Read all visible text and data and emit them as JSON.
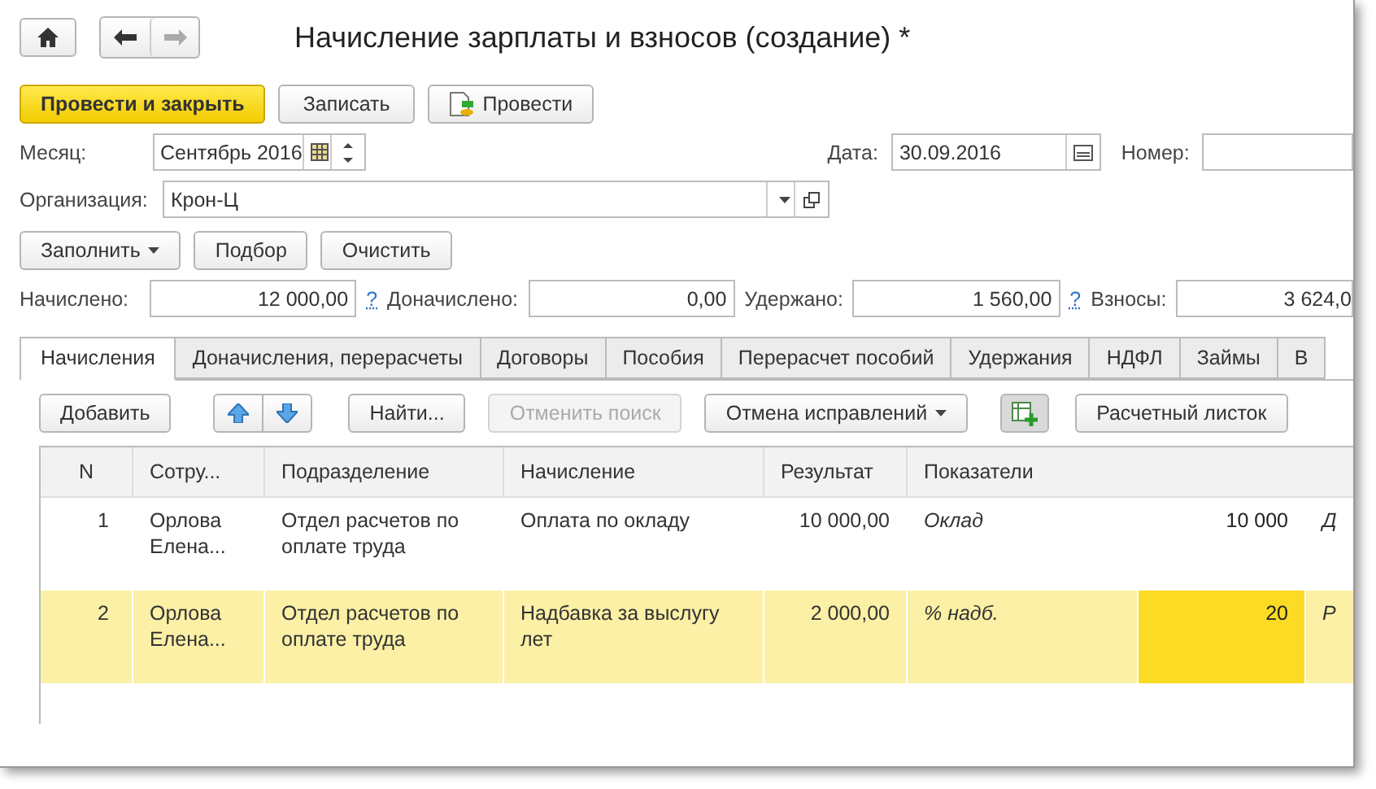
{
  "window": {
    "title": "Начисление зарплаты и взносов (создание) *"
  },
  "actions": [
    {
      "label": "Провести и закрыть",
      "kind": "primary"
    },
    {
      "label": "Записать",
      "kind": "plain"
    },
    {
      "label": "Провести",
      "kind": "post"
    }
  ],
  "month": {
    "label": "Месяц:",
    "value": "Сентябрь 2016"
  },
  "date": {
    "label": "Дата:",
    "value": "30.09.2016"
  },
  "number": {
    "label": "Номер:"
  },
  "organization": {
    "label": "Организация:",
    "value": "Крон-Ц"
  },
  "fill_buttons": [
    {
      "label": "Заполнить",
      "dropdown": true
    },
    {
      "label": "Подбор",
      "dropdown": false
    },
    {
      "label": "Очистить",
      "dropdown": false
    }
  ],
  "totals": [
    {
      "label": "Начислено:",
      "value": "12 000,00",
      "help": "?"
    },
    {
      "label": "Доначислено:",
      "value": "0,00"
    },
    {
      "label": "Удержано:",
      "value": "1 560,00",
      "help": "?"
    },
    {
      "label": "Взносы:",
      "value": "3 624,0"
    }
  ],
  "tabs": [
    {
      "label": "Начисления",
      "selected": true
    },
    {
      "label": "Доначисления, перерасчеты",
      "selected": false
    },
    {
      "label": "Договоры",
      "selected": false
    },
    {
      "label": "Пособия",
      "selected": false
    },
    {
      "label": "Перерасчет пособий",
      "selected": false
    },
    {
      "label": "Удержания",
      "selected": false
    },
    {
      "label": "НДФЛ",
      "selected": false
    },
    {
      "label": "Займы",
      "selected": false
    },
    {
      "label": "В",
      "selected": false
    }
  ],
  "toolbar": [
    {
      "kind": "button",
      "label": "Добавить",
      "disabled": false
    },
    {
      "kind": "arrows"
    },
    {
      "kind": "button",
      "label": "Найти...",
      "disabled": false
    },
    {
      "kind": "button",
      "label": "Отменить поиск",
      "disabled": true
    },
    {
      "kind": "dropdown",
      "label": "Отмена исправлений",
      "disabled": false
    },
    {
      "kind": "toggle",
      "on": true
    },
    {
      "kind": "button",
      "label": "Расчетный листок",
      "disabled": false
    }
  ],
  "table": {
    "columns": [
      "N",
      "Сотру...",
      "Подразделение",
      "Начисление",
      "Результат",
      "Показатели"
    ],
    "rows": [
      {
        "n": "1",
        "employee": "Орлова Елена...",
        "department": "Отдел расчетов по оплате труда",
        "accrual": "Оплата по окладу",
        "result": "10 000,00",
        "indicator": "Оклад",
        "indicator_value": "10 000",
        "column_8": "Д",
        "selected": false
      },
      {
        "n": "2",
        "employee": "Орлова Елена...",
        "department": "Отдел расчетов по оплате труда",
        "accrual": "Надбавка за выслугу лет",
        "result": "2 000,00",
        "indicator": "% надб.",
        "indicator_value": "20",
        "column_8": "Р",
        "selected": true
      }
    ]
  }
}
